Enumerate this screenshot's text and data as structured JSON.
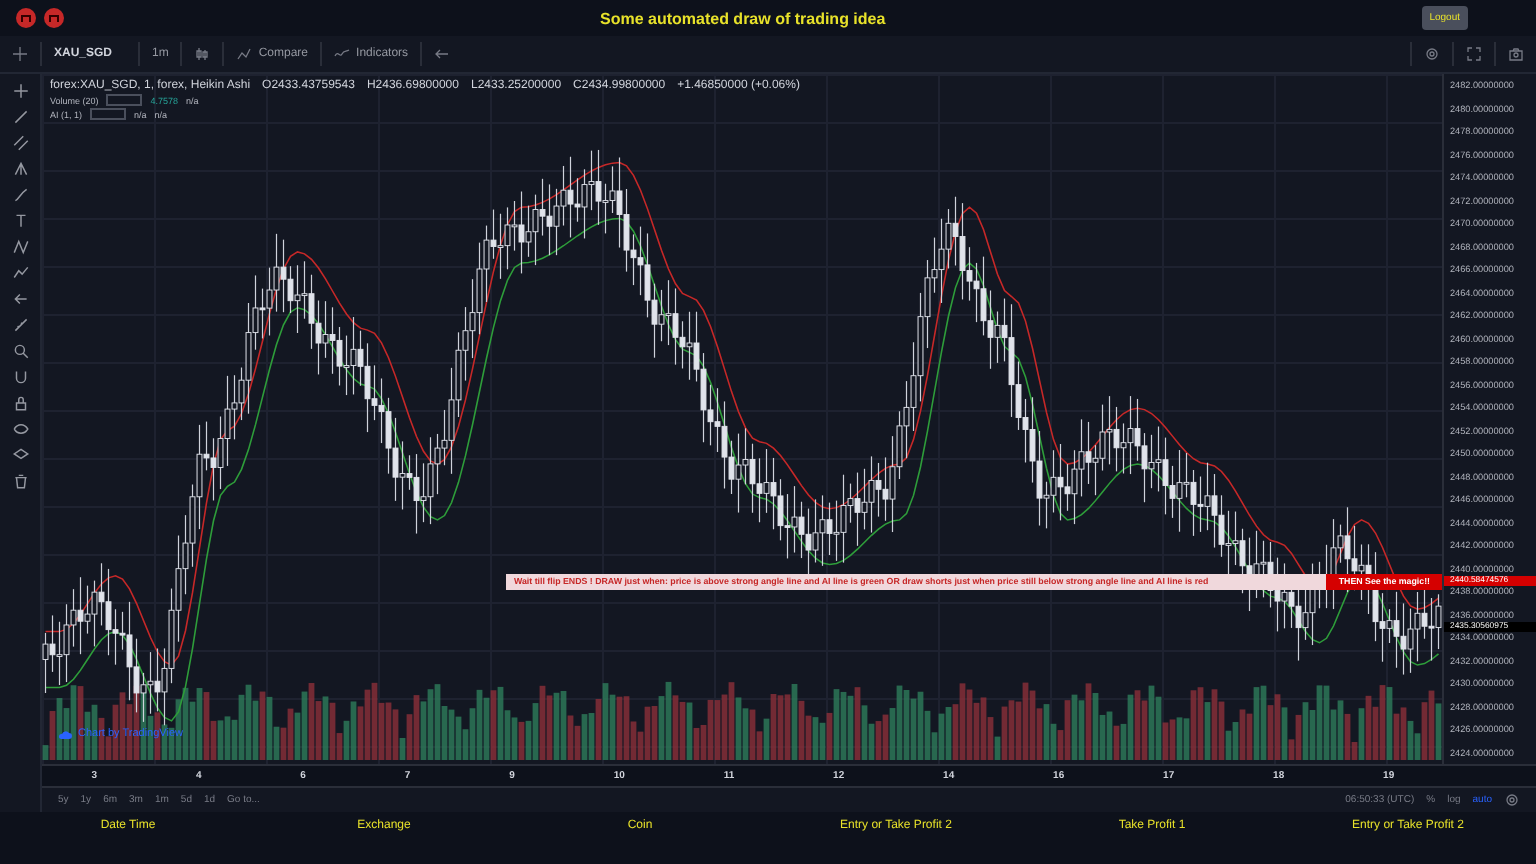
{
  "header": {
    "title": "Some automated draw of trading idea",
    "logout": "Logout"
  },
  "toolbar": {
    "symbol": "XAU_SGD",
    "interval": "1m",
    "compare": "Compare",
    "indicators": "Indicators"
  },
  "legend": {
    "series": "forex:XAU_SGD, 1, forex, Heikin Ashi",
    "ohlc": [
      "O2433.43759543",
      "H2436.69800000",
      "L2433.25200000",
      "C2434.99800000"
    ],
    "change": "+1.46850000 (+0.06%)",
    "studies": [
      {
        "name": "Volume (20)",
        "value": "4.7578",
        "readings": [
          "n/a"
        ]
      },
      {
        "name": "AI (1, 1)",
        "readings": [
          "n/a",
          "n/a"
        ]
      }
    ]
  },
  "annotation": {
    "text": "Wait till flip ENDS !   DRAW just when:  price is above strong angle line and AI line is green      OR      draw shorts just when price still below strong angle line and AI line is red",
    "cta": "THEN See the magic!!"
  },
  "attribution": "Chart by TradingView",
  "price_axis": {
    "labels": [
      "2482.00000000",
      "2480.00000000",
      "2478.00000000",
      "2476.00000000",
      "2474.00000000",
      "2472.00000000",
      "2470.00000000",
      "2468.00000000",
      "2466.00000000",
      "2464.00000000",
      "2462.00000000",
      "2460.00000000",
      "2458.00000000",
      "2456.00000000",
      "2454.00000000",
      "2452.00000000",
      "2450.00000000",
      "2448.00000000",
      "2446.00000000",
      "2444.00000000",
      "2442.00000000",
      "2440.00000000",
      "2438.00000000",
      "2436.00000000",
      "2434.00000000",
      "2432.00000000",
      "2430.00000000",
      "2428.00000000",
      "2426.00000000",
      "2424.00000000"
    ],
    "markers": [
      {
        "label": "2440.58474576",
        "kind": "signal"
      },
      {
        "label": "2435.30560975",
        "kind": "last"
      }
    ]
  },
  "time_axis": [
    "3",
    "4",
    "6",
    "7",
    "9",
    "10",
    "11",
    "12",
    "14",
    "16",
    "17",
    "18",
    "19"
  ],
  "range_bar": {
    "ranges": [
      "5y",
      "1y",
      "6m",
      "3m",
      "1m",
      "5d",
      "1d"
    ],
    "goto": "Go to...",
    "clock": "06:50:33 (UTC)",
    "percent": "%",
    "log": "log",
    "auto": "auto"
  },
  "footer": [
    "Date Time",
    "Exchange",
    "Coin",
    "Entry or Take Profit 2",
    "Take Profit 1",
    "Entry or Take Profit 2"
  ]
}
